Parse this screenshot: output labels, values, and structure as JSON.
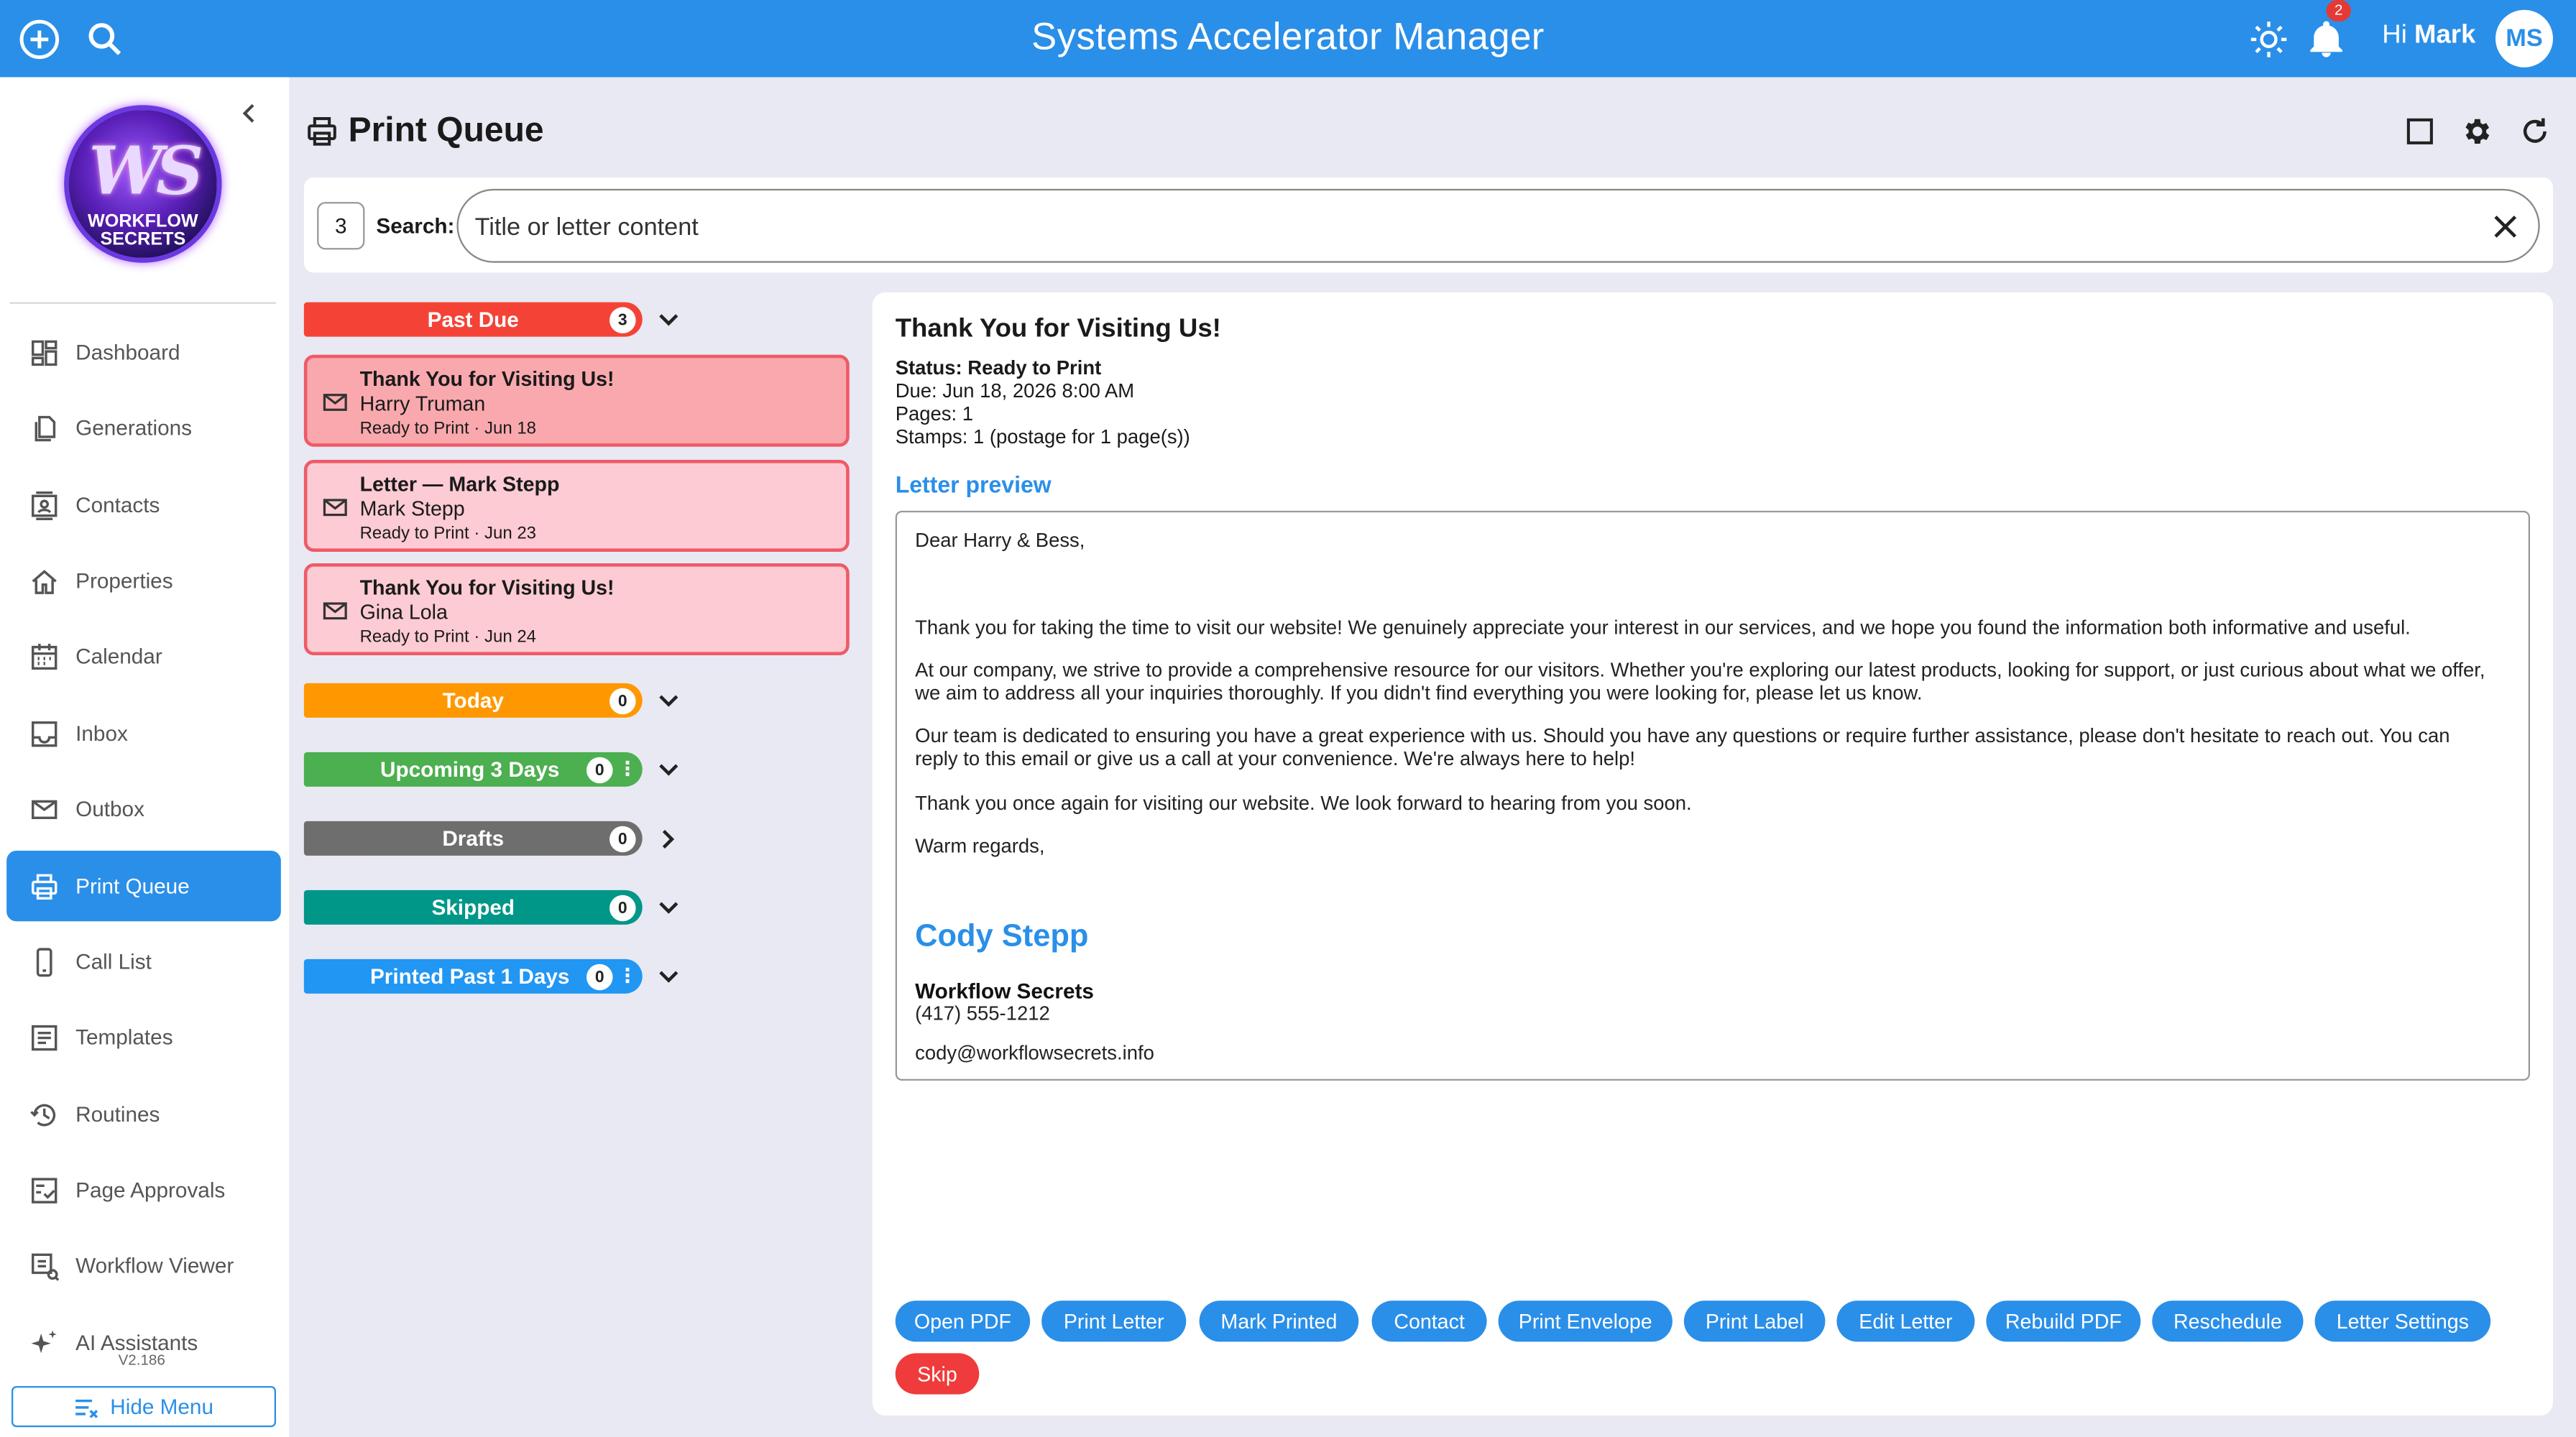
{
  "app": {
    "title": "Systems Accelerator Manager"
  },
  "topbar": {
    "greeting": "Hi",
    "user_name": "Mark",
    "avatar_initials": "MS",
    "notification_count": "2"
  },
  "colors": {
    "primary": "#2a8fe8",
    "past_due": "#f44336",
    "today": "#ff9800",
    "upcoming": "#4caf50",
    "drafts": "#6e6e6e",
    "skipped": "#009688",
    "printed": "#2196f3",
    "card_first": "#f9a9ae",
    "card_other": "#fdcbd3"
  },
  "logo": {
    "top": "WS",
    "bottom_line1": "WORKFLOW",
    "bottom_line2": "SECRETS"
  },
  "sidebar": {
    "items": [
      {
        "label": "Dashboard",
        "icon": "dashboard-icon"
      },
      {
        "label": "Generations",
        "icon": "copy-icon"
      },
      {
        "label": "Contacts",
        "icon": "contact-card-icon"
      },
      {
        "label": "Properties",
        "icon": "house-icon"
      },
      {
        "label": "Calendar",
        "icon": "calendar-icon"
      },
      {
        "label": "Inbox",
        "icon": "inbox-icon"
      },
      {
        "label": "Outbox",
        "icon": "mail-icon"
      },
      {
        "label": "Print Queue",
        "icon": "printer-icon",
        "active": true
      },
      {
        "label": "Call List",
        "icon": "phone-icon"
      },
      {
        "label": "Templates",
        "icon": "document-icon"
      },
      {
        "label": "Routines",
        "icon": "history-icon"
      },
      {
        "label": "Page Approvals",
        "icon": "approval-icon"
      },
      {
        "label": "Workflow Viewer",
        "icon": "workflow-icon"
      },
      {
        "label": "AI Assistants",
        "icon": "sparkle-icon"
      }
    ],
    "version": "V2.186",
    "hide_menu_label": "Hide Menu"
  },
  "page": {
    "title": "Print Queue"
  },
  "search": {
    "count": "3",
    "label": "Search:",
    "placeholder": "Title or letter content"
  },
  "groups": [
    {
      "label": "Past Due",
      "count": "3",
      "expanded": true
    },
    {
      "label": "Today",
      "count": "0",
      "expanded": true
    },
    {
      "label": "Upcoming 3 Days",
      "count": "0",
      "expanded": true
    },
    {
      "label": "Drafts",
      "count": "0",
      "expanded": false
    },
    {
      "label": "Skipped",
      "count": "0",
      "expanded": true
    },
    {
      "label": "Printed Past 1 Days",
      "count": "0",
      "expanded": true
    }
  ],
  "cards": [
    {
      "title": "Thank You for Visiting Us!",
      "name": "Harry Truman",
      "meta": "Ready to Print · Jun 18"
    },
    {
      "title": "Letter — Mark Stepp",
      "name": "Mark Stepp",
      "meta": "Ready to Print · Jun 23"
    },
    {
      "title": "Thank You for Visiting Us!",
      "name": "Gina Lola",
      "meta": "Ready to Print · Jun 24"
    }
  ],
  "detail": {
    "title": "Thank You for Visiting Us!",
    "status": "Status: Ready to Print",
    "due": "Due: Jun 18, 2026 8:00 AM",
    "pages": "Pages: 1",
    "stamps": "Stamps: 1 (postage for 1 page(s))",
    "preview_heading": "Letter preview",
    "letter": {
      "greeting": "Dear Harry & Bess,",
      "p1": "Thank you for taking the time to visit our website! We genuinely appreciate your interest in our services, and we hope you found the information both informative and useful.",
      "p2": "At our company, we strive to provide a comprehensive resource for our visitors. Whether you're exploring our latest products, looking for support, or just curious about what we offer, we aim to address all your inquiries thoroughly. If you didn't find everything you were looking for, please let us know.",
      "p3": "Our team is dedicated to ensuring you have a great experience with us. Should you have any questions or require further assistance, please don't hesitate to reach out. You can reply to this email or give us a call at your convenience. We're always here to help!",
      "p4": "Thank you once again for visiting our website. We look forward to hearing from you soon.",
      "closing": "Warm regards,",
      "sig_name": "Cody Stepp",
      "sig_company": "Workflow Secrets",
      "sig_phone": "(417) 555-1212",
      "sig_email": "cody@workflowsecrets.info"
    },
    "actions": [
      "Open PDF",
      "Print Letter",
      "Mark Printed",
      "Contact",
      "Print Envelope",
      "Print Label",
      "Edit Letter",
      "Rebuild PDF",
      "Reschedule",
      "Letter Settings",
      "Skip"
    ]
  }
}
